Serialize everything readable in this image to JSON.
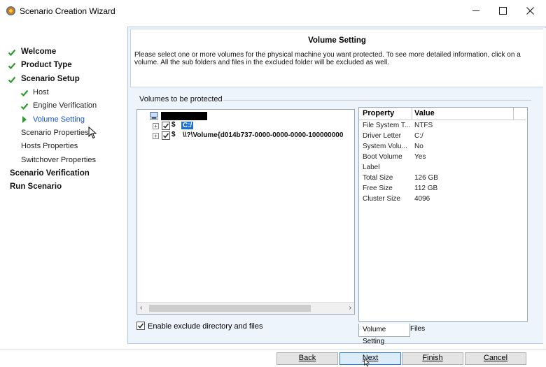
{
  "window": {
    "title": "Scenario Creation Wizard"
  },
  "sidebar": {
    "items": [
      {
        "label": "Welcome",
        "state": "done",
        "level": 0
      },
      {
        "label": "Product Type",
        "state": "done",
        "level": 0
      },
      {
        "label": "Scenario Setup",
        "state": "done",
        "level": 0
      },
      {
        "label": "Host",
        "state": "done",
        "level": 1
      },
      {
        "label": "Engine Verification",
        "state": "done",
        "level": 1
      },
      {
        "label": "Volume Setting",
        "state": "current",
        "level": 1
      },
      {
        "label": "Scenario Properties",
        "state": "pending",
        "level": 1
      },
      {
        "label": "Hosts Properties",
        "state": "pending",
        "level": 1
      },
      {
        "label": "Switchover Properties",
        "state": "pending",
        "level": 1
      },
      {
        "label": "Scenario Verification",
        "state": "pending",
        "level": 0
      },
      {
        "label": "Run Scenario",
        "state": "pending",
        "level": 0
      }
    ]
  },
  "header": {
    "title": "Volume Setting",
    "description": "Please select one or more volumes for the physical machine you want protected. To see more detailed information, click on a volume. All the sub folders and files in the excluded folder will be excluded as well."
  },
  "volumes": {
    "group_label": "Volumes to be protected",
    "items": [
      {
        "label": "C:/",
        "checked": true,
        "selected": true
      },
      {
        "label": "\\\\?\\Volume{d014b737-0000-0000-0000-100000000",
        "checked": true,
        "selected": false
      }
    ]
  },
  "properties": {
    "col_property": "Property",
    "col_value": "Value",
    "rows": [
      {
        "key": "File System T...",
        "value": "NTFS"
      },
      {
        "key": "Driver Letter",
        "value": "C:/"
      },
      {
        "key": "System Volu...",
        "value": "No"
      },
      {
        "key": "Boot Volume",
        "value": "Yes"
      },
      {
        "key": "Label",
        "value": ""
      },
      {
        "key": "Total Size",
        "value": "126 GB"
      },
      {
        "key": "Free Size",
        "value": "112 GB"
      },
      {
        "key": "Cluster Size",
        "value": "4096"
      }
    ]
  },
  "tabs": {
    "volume_setting": "Volume Setting",
    "files": "Files"
  },
  "exclude": {
    "label": "Enable exclude directory and files",
    "checked": true
  },
  "footer": {
    "back": "Back",
    "next": "Next",
    "finish": "Finish",
    "cancel": "Cancel"
  },
  "colors": {
    "accent": "#1a6fe0",
    "check_green": "#2e9b2e",
    "panel_bg": "#eef4fb"
  }
}
